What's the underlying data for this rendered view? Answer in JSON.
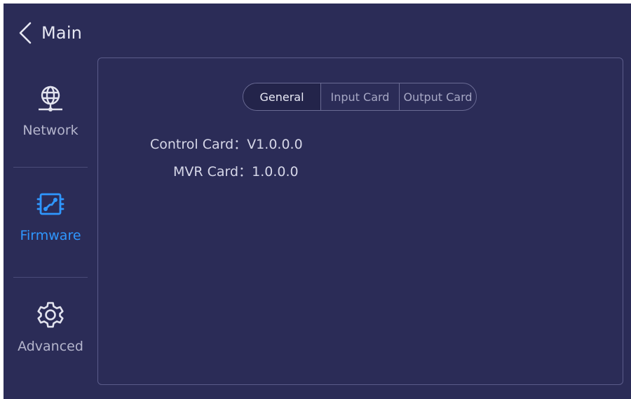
{
  "header": {
    "back_label": "Main"
  },
  "sidebar": {
    "items": [
      {
        "label": "Network",
        "icon": "globe-icon",
        "active": false
      },
      {
        "label": "Firmware",
        "icon": "circuit-board-icon",
        "active": true
      },
      {
        "label": "Advanced",
        "icon": "gear-icon",
        "active": false
      }
    ]
  },
  "tabs": [
    {
      "label": "General",
      "active": true
    },
    {
      "label": "Input Card",
      "active": false
    },
    {
      "label": "Output Card",
      "active": false
    }
  ],
  "firmware_info": [
    {
      "label": "Control Card",
      "separator": "：",
      "value": "V1.0.0.0"
    },
    {
      "label": "MVR Card",
      "separator": "：",
      "value": "1.0.0.0"
    }
  ],
  "colors": {
    "background": "#2b2c57",
    "accent": "#2f97ff",
    "text": "#d6d7e8",
    "muted_text": "#b4b5cc"
  }
}
